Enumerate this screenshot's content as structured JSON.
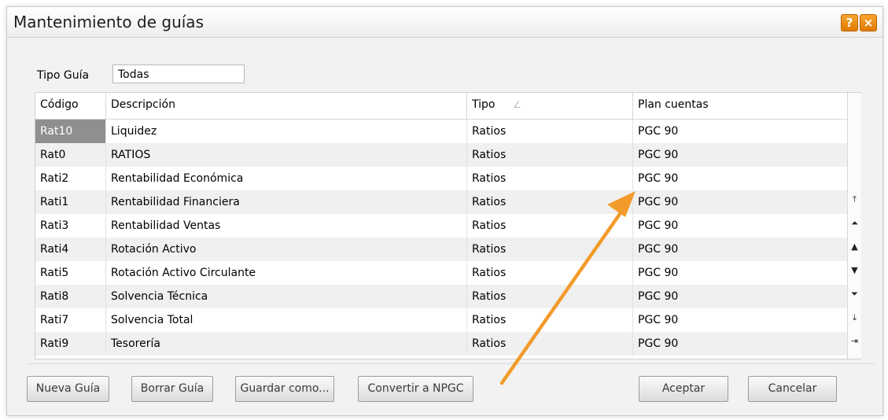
{
  "window": {
    "title": "Mantenimiento de guías",
    "help_label": "?",
    "close_label": "×"
  },
  "filter": {
    "label": "Tipo Guía",
    "value": "Todas"
  },
  "grid": {
    "columns": [
      "Código",
      "Descripción",
      "Tipo",
      "Plan cuentas"
    ],
    "sort_indicator": "∠",
    "rows": [
      {
        "code": "Rat10",
        "desc": "Liquidez",
        "tipo": "Ratios",
        "plan": "PGC 90"
      },
      {
        "code": "Rat0",
        "desc": "RATIOS",
        "tipo": "Ratios",
        "plan": "PGC 90"
      },
      {
        "code": "Rati2",
        "desc": "Rentabilidad Económica",
        "tipo": "Ratios",
        "plan": "PGC 90"
      },
      {
        "code": "Rati1",
        "desc": "Rentabilidad Financiera",
        "tipo": "Ratios",
        "plan": "PGC 90"
      },
      {
        "code": "Rati3",
        "desc": "Rentabilidad Ventas",
        "tipo": "Ratios",
        "plan": "PGC 90"
      },
      {
        "code": "Rati4",
        "desc": "Rotación Activo",
        "tipo": "Ratios",
        "plan": "PGC 90"
      },
      {
        "code": "Rati5",
        "desc": "Rotación Activo Circulante",
        "tipo": "Ratios",
        "plan": "PGC 90"
      },
      {
        "code": "Rati8",
        "desc": "Solvencia Técnica",
        "tipo": "Ratios",
        "plan": "PGC 90"
      },
      {
        "code": "Rati7",
        "desc": "Solvencia Total",
        "tipo": "Ratios",
        "plan": "PGC 90"
      },
      {
        "code": "Rati9",
        "desc": "Tesorería",
        "tipo": "Ratios",
        "plan": "PGC 90"
      }
    ],
    "scroll_buttons": [
      {
        "name": "first-page-icon",
        "glyph": "⤒"
      },
      {
        "name": "page-up-icon",
        "glyph": "⏶"
      },
      {
        "name": "row-up-icon",
        "glyph": "▲"
      },
      {
        "name": "row-down-icon",
        "glyph": "▼"
      },
      {
        "name": "page-down-icon",
        "glyph": "⏷"
      },
      {
        "name": "last-page-icon",
        "glyph": "⤓"
      },
      {
        "name": "export-icon",
        "glyph": "⇥"
      }
    ]
  },
  "buttons": {
    "new": "Nueva Guía",
    "delete": "Borrar Guía",
    "save_as": "Guardar como...",
    "convert": "Convertir a NPGC",
    "accept": "Aceptar",
    "cancel": "Cancelar"
  },
  "colors": {
    "accent_orange": "#f29b2b",
    "selected_cell": "#8f8f8f"
  }
}
